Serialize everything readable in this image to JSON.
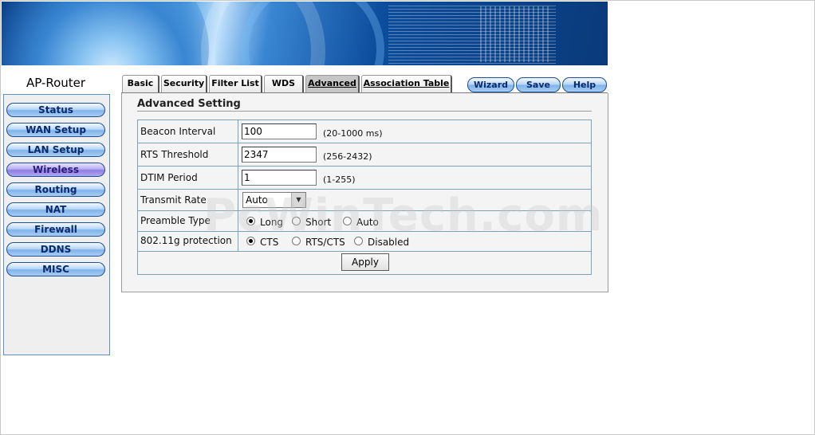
{
  "app": {
    "title": "AP-Router"
  },
  "sidebar": {
    "items": [
      {
        "label": "Status"
      },
      {
        "label": "WAN Setup"
      },
      {
        "label": "LAN Setup"
      },
      {
        "label": "Wireless"
      },
      {
        "label": "Routing"
      },
      {
        "label": "NAT"
      },
      {
        "label": "Firewall"
      },
      {
        "label": "DDNS"
      },
      {
        "label": "MISC"
      }
    ]
  },
  "tabs": [
    {
      "label": "Basic"
    },
    {
      "label": "Security"
    },
    {
      "label": "Filter List"
    },
    {
      "label": "WDS"
    },
    {
      "label": "Advanced"
    },
    {
      "label": "Association Table"
    }
  ],
  "actions": {
    "wizard": "Wizard",
    "save": "Save",
    "help": "Help"
  },
  "form": {
    "title": "Advanced Setting",
    "beacon": {
      "label": "Beacon Interval",
      "value": "100",
      "hint": "(20-1000 ms)"
    },
    "rts": {
      "label": "RTS Threshold",
      "value": "2347",
      "hint": "(256-2432)"
    },
    "dtim": {
      "label": "DTIM Period",
      "value": "1",
      "hint": "(1-255)"
    },
    "rate": {
      "label": "Transmit Rate",
      "value": "Auto"
    },
    "preamble": {
      "label": "Preamble Type",
      "options": [
        "Long",
        "Short",
        "Auto"
      ],
      "selected": "Long"
    },
    "protection": {
      "label": "802.11g protection",
      "options": [
        "CTS",
        "RTS/CTS",
        "Disabled"
      ],
      "selected": "CTS"
    },
    "apply": "Apply"
  },
  "watermark": "PcWinTech.com",
  "colors": {
    "menu_blue": "#7fb3ea",
    "menu_active": "#8f7ee3",
    "border": "#7aa3b5"
  }
}
